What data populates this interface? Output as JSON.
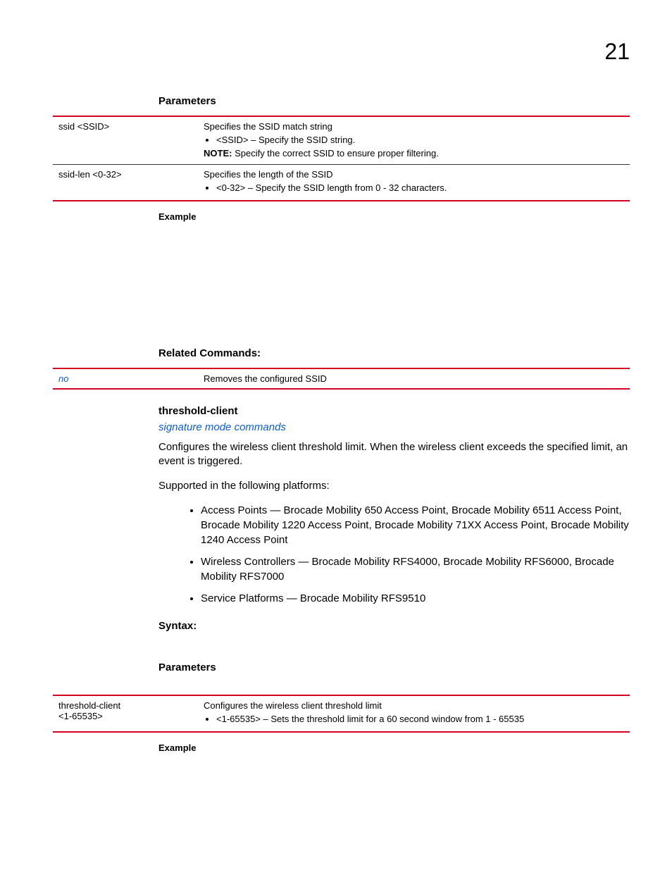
{
  "pageNumber": "21",
  "section1": {
    "heading": "Parameters",
    "rows": [
      {
        "key": "ssid <SSID>",
        "lead": "Specifies the SSID match string",
        "bullet": "<SSID> – Specify the SSID string.",
        "noteLabel": "NOTE:",
        "noteText": "  Specify the correct SSID to ensure proper filtering."
      },
      {
        "key": "ssid-len <0-32>",
        "lead": "Specifies the length of the SSID",
        "bullet": "<0-32> – Specify the SSID length from 0 - 32 characters."
      }
    ],
    "exampleLabel": "Example"
  },
  "related": {
    "heading": "Related Commands:",
    "row": {
      "key": "no",
      "desc": "Removes the configured SSID"
    }
  },
  "thresholdSection": {
    "title": "threshold-client",
    "subhead": "signature mode commands",
    "desc": "Configures the wireless client threshold limit. When the wireless client exceeds the specified limit, an event is triggered.",
    "supportedLead": "Supported in the following platforms:",
    "platforms": [
      "Access Points — Brocade Mobility 650 Access Point, Brocade Mobility 6511 Access Point, Brocade Mobility 1220 Access Point, Brocade Mobility 71XX Access Point, Brocade Mobility 1240 Access Point",
      "Wireless Controllers — Brocade Mobility RFS4000, Brocade Mobility RFS6000, Brocade Mobility RFS7000",
      "Service Platforms — Brocade Mobility RFS9510"
    ],
    "syntaxLabel": "Syntax:",
    "paramsLabel": "Parameters",
    "paramRow": {
      "key1": "threshold-client",
      "key2": "<1-65535>",
      "lead": "Configures the wireless client threshold limit",
      "bullet": "<1-65535> – Sets the threshold limit for a 60 second window from 1 - 65535"
    },
    "exampleLabel": "Example"
  }
}
